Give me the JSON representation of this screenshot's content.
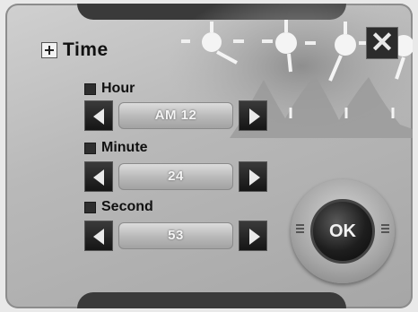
{
  "dialog": {
    "title": "Time",
    "close_label": "✕",
    "ok_label": "OK"
  },
  "fields": [
    {
      "label": "Hour",
      "value": "AM 12"
    },
    {
      "label": "Minute",
      "value": "24"
    },
    {
      "label": "Second",
      "value": "53"
    }
  ],
  "icons": {
    "title": "plus-icon",
    "close": "close-icon",
    "decrement": "arrow-left-icon",
    "increment": "arrow-right-icon"
  }
}
